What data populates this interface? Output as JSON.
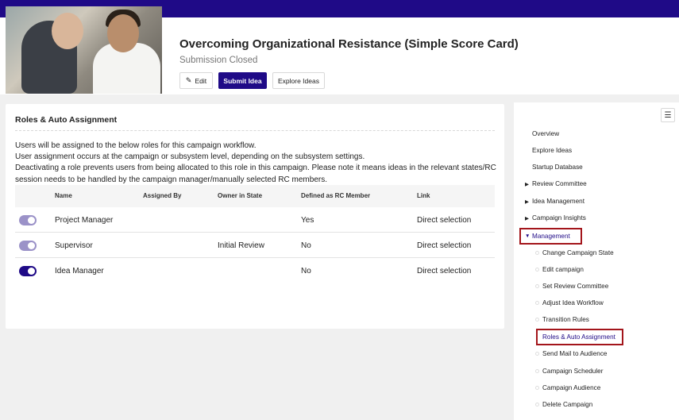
{
  "header": {
    "title": "Overcoming Organizational Resistance (Simple Score Card)",
    "status": "Submission Closed",
    "buttons": {
      "edit": "Edit",
      "submit": "Submit Idea",
      "explore": "Explore Ideas"
    }
  },
  "panel": {
    "title": "Roles & Auto Assignment",
    "description": [
      "Users will be assigned to the below roles for this campaign workflow.",
      "User assignment occurs at the campaign or subsystem level, depending on the subsystem settings.",
      "Deactivating a role prevents users from being allocated to this role in this campaign. Please note it means ideas in the relevant states/RC",
      "session needs to be handled by the campaign manager/manually selected RC members."
    ],
    "columns": [
      "Name",
      "Assigned By",
      "Owner in State",
      "Defined as RC Member",
      "Link"
    ],
    "rows": [
      {
        "enabled": true,
        "name": "Project Manager",
        "assigned_by": "",
        "owner_in_state": "",
        "rc_member": "Yes",
        "link": "Direct selection"
      },
      {
        "enabled": true,
        "name": "Supervisor",
        "assigned_by": "",
        "owner_in_state": "Initial Review",
        "rc_member": "No",
        "link": "Direct selection"
      },
      {
        "enabled": true,
        "name": "Idea Manager",
        "assigned_by": "",
        "owner_in_state": "",
        "rc_member": "No",
        "link": "Direct selection"
      }
    ]
  },
  "sidebar": {
    "top": [
      "Overview",
      "Explore Ideas",
      "Startup Database"
    ],
    "groups": [
      "Review Committee",
      "Idea Management",
      "Campaign Insights",
      "Management"
    ],
    "management_items": [
      "Change Campaign State",
      "Edit campaign",
      "Set Review Committee",
      "Adjust Idea Workflow",
      "Transition Rules",
      "Roles & Auto Assignment",
      "Send Mail to Audience",
      "Campaign Scheduler",
      "Campaign Audience",
      "Delete Campaign"
    ]
  },
  "colors": {
    "brand": "#1f0a87",
    "highlight": "#a3151b",
    "toggle_light": "#9b92c8"
  },
  "icons": {
    "edit": "pencil-icon",
    "menu": "hamburger-icon",
    "expand": "caret-right-icon",
    "collapse": "caret-down-icon"
  }
}
